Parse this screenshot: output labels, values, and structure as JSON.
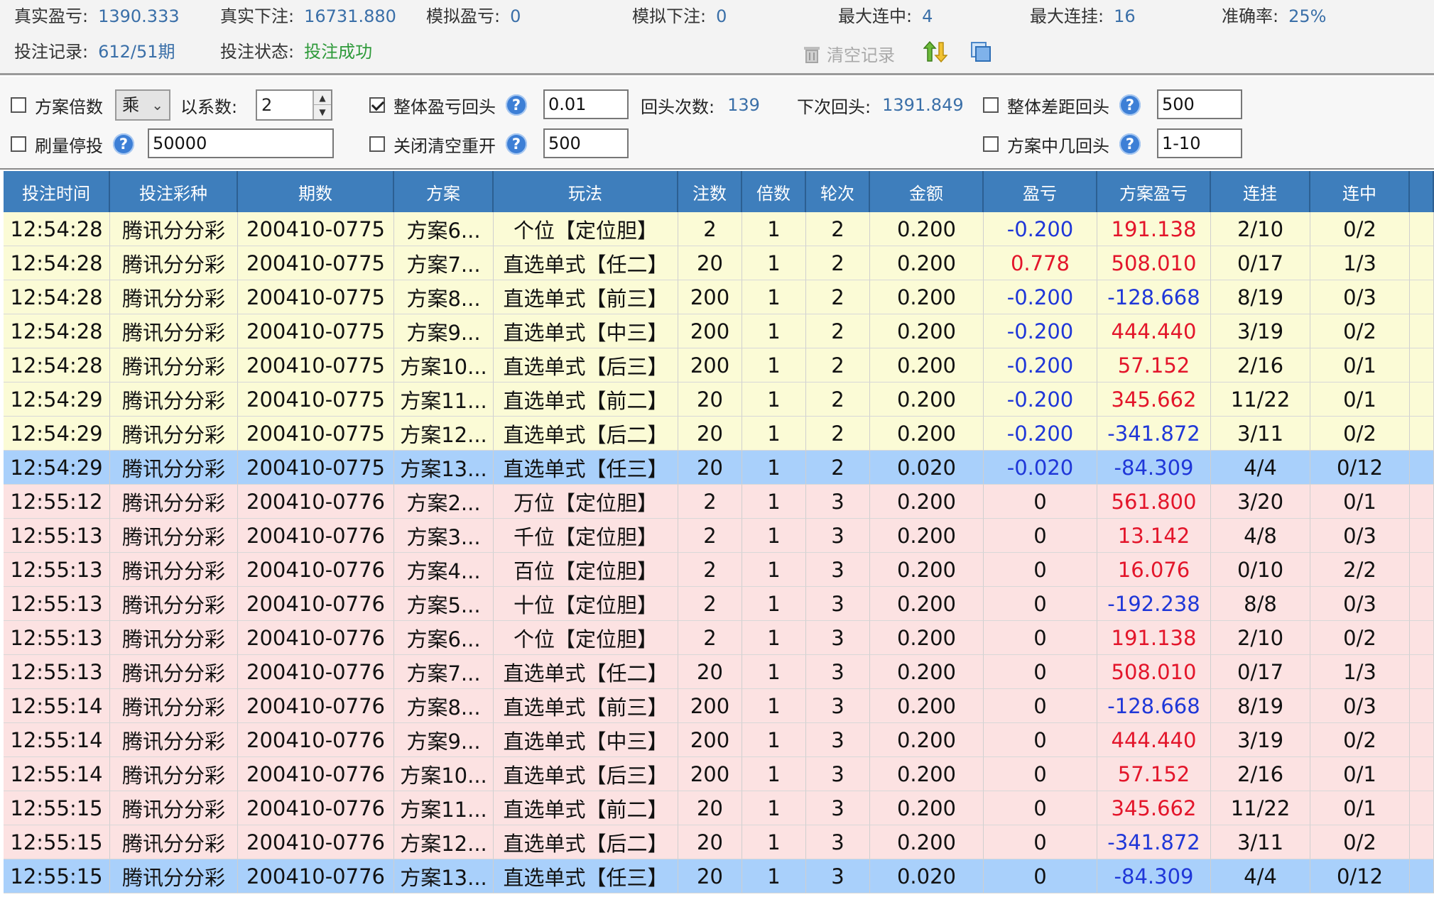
{
  "stats": {
    "real_profit_label": "真实盈亏:",
    "real_profit": "1390.333",
    "real_bet_label": "真实下注:",
    "real_bet": "16731.880",
    "sim_profit_label": "模拟盈亏:",
    "sim_profit": "0",
    "sim_bet_label": "模拟下注:",
    "sim_bet": "0",
    "max_win_streak_label": "最大连中:",
    "max_win_streak": "4",
    "max_loss_streak_label": "最大连挂:",
    "max_loss_streak": "16",
    "accuracy_label": "准确率:",
    "accuracy": "25%",
    "record_label": "投注记录:",
    "record": "612/51期",
    "status_label": "投注状态:",
    "status": "投注成功",
    "clear_label": "清空记录"
  },
  "settings": {
    "multiplier_label": "方案倍数",
    "op_value": "乘",
    "coef_label": "以系数:",
    "coef_value": "2",
    "overall_return_label": "整体盈亏回头",
    "overall_return_value": "0.01",
    "return_count_label": "回头次数:",
    "return_count": "139",
    "next_return_label": "下次回头:",
    "next_return": "1391.849",
    "gap_return_label": "整体差距回头",
    "gap_return_value": "500",
    "stop_label": "刷量停投",
    "stop_value": "50000",
    "close_label": "关闭清空重开",
    "close_value": "500",
    "hit_return_label": "方案中几回头",
    "hit_return_value": "1-10"
  },
  "columns": [
    "投注时间",
    "投注彩种",
    "期数",
    "方案",
    "玩法",
    "注数",
    "倍数",
    "轮次",
    "金额",
    "盈亏",
    "方案盈亏",
    "连挂",
    "连中"
  ],
  "rows": [
    {
      "bg": "yellow",
      "c": [
        "12:54:28",
        "腾讯分分彩",
        "200410-0775",
        "方案6...",
        "个位【定位胆】",
        "2",
        "1",
        "2",
        "0.200",
        "-0.200",
        "191.138",
        "2/10",
        "0/2"
      ]
    },
    {
      "bg": "yellow",
      "c": [
        "12:54:28",
        "腾讯分分彩",
        "200410-0775",
        "方案7...",
        "直选单式【任二】",
        "20",
        "1",
        "2",
        "0.200",
        "0.778",
        "508.010",
        "0/17",
        "1/3"
      ]
    },
    {
      "bg": "yellow",
      "c": [
        "12:54:28",
        "腾讯分分彩",
        "200410-0775",
        "方案8...",
        "直选单式【前三】",
        "200",
        "1",
        "2",
        "0.200",
        "-0.200",
        "-128.668",
        "8/19",
        "0/3"
      ]
    },
    {
      "bg": "yellow",
      "c": [
        "12:54:28",
        "腾讯分分彩",
        "200410-0775",
        "方案9...",
        "直选单式【中三】",
        "200",
        "1",
        "2",
        "0.200",
        "-0.200",
        "444.440",
        "3/19",
        "0/2"
      ]
    },
    {
      "bg": "yellow",
      "c": [
        "12:54:28",
        "腾讯分分彩",
        "200410-0775",
        "方案10...",
        "直选单式【后三】",
        "200",
        "1",
        "2",
        "0.200",
        "-0.200",
        "57.152",
        "2/16",
        "0/1"
      ]
    },
    {
      "bg": "yellow",
      "c": [
        "12:54:29",
        "腾讯分分彩",
        "200410-0775",
        "方案11...",
        "直选单式【前二】",
        "20",
        "1",
        "2",
        "0.200",
        "-0.200",
        "345.662",
        "11/22",
        "0/1"
      ]
    },
    {
      "bg": "yellow",
      "c": [
        "12:54:29",
        "腾讯分分彩",
        "200410-0775",
        "方案12...",
        "直选单式【后二】",
        "20",
        "1",
        "2",
        "0.200",
        "-0.200",
        "-341.872",
        "3/11",
        "0/2"
      ]
    },
    {
      "bg": "blue",
      "c": [
        "12:54:29",
        "腾讯分分彩",
        "200410-0775",
        "方案13...",
        "直选单式【任三】",
        "20",
        "1",
        "2",
        "0.020",
        "-0.020",
        "-84.309",
        "4/4",
        "0/12"
      ]
    },
    {
      "bg": "pink",
      "c": [
        "12:55:12",
        "腾讯分分彩",
        "200410-0776",
        "方案2...",
        "万位【定位胆】",
        "2",
        "1",
        "3",
        "0.200",
        "0",
        "561.800",
        "3/20",
        "0/1"
      ]
    },
    {
      "bg": "pink",
      "c": [
        "12:55:13",
        "腾讯分分彩",
        "200410-0776",
        "方案3...",
        "千位【定位胆】",
        "2",
        "1",
        "3",
        "0.200",
        "0",
        "13.142",
        "4/8",
        "0/3"
      ]
    },
    {
      "bg": "pink",
      "c": [
        "12:55:13",
        "腾讯分分彩",
        "200410-0776",
        "方案4...",
        "百位【定位胆】",
        "2",
        "1",
        "3",
        "0.200",
        "0",
        "16.076",
        "0/10",
        "2/2"
      ]
    },
    {
      "bg": "pink",
      "c": [
        "12:55:13",
        "腾讯分分彩",
        "200410-0776",
        "方案5...",
        "十位【定位胆】",
        "2",
        "1",
        "3",
        "0.200",
        "0",
        "-192.238",
        "8/8",
        "0/3"
      ]
    },
    {
      "bg": "pink",
      "c": [
        "12:55:13",
        "腾讯分分彩",
        "200410-0776",
        "方案6...",
        "个位【定位胆】",
        "2",
        "1",
        "3",
        "0.200",
        "0",
        "191.138",
        "2/10",
        "0/2"
      ]
    },
    {
      "bg": "pink",
      "c": [
        "12:55:13",
        "腾讯分分彩",
        "200410-0776",
        "方案7...",
        "直选单式【任二】",
        "20",
        "1",
        "3",
        "0.200",
        "0",
        "508.010",
        "0/17",
        "1/3"
      ]
    },
    {
      "bg": "pink",
      "c": [
        "12:55:14",
        "腾讯分分彩",
        "200410-0776",
        "方案8...",
        "直选单式【前三】",
        "200",
        "1",
        "3",
        "0.200",
        "0",
        "-128.668",
        "8/19",
        "0/3"
      ]
    },
    {
      "bg": "pink",
      "c": [
        "12:55:14",
        "腾讯分分彩",
        "200410-0776",
        "方案9...",
        "直选单式【中三】",
        "200",
        "1",
        "3",
        "0.200",
        "0",
        "444.440",
        "3/19",
        "0/2"
      ]
    },
    {
      "bg": "pink",
      "c": [
        "12:55:14",
        "腾讯分分彩",
        "200410-0776",
        "方案10...",
        "直选单式【后三】",
        "200",
        "1",
        "3",
        "0.200",
        "0",
        "57.152",
        "2/16",
        "0/1"
      ]
    },
    {
      "bg": "pink",
      "c": [
        "12:55:15",
        "腾讯分分彩",
        "200410-0776",
        "方案11...",
        "直选单式【前二】",
        "20",
        "1",
        "3",
        "0.200",
        "0",
        "345.662",
        "11/22",
        "0/1"
      ]
    },
    {
      "bg": "pink",
      "c": [
        "12:55:15",
        "腾讯分分彩",
        "200410-0776",
        "方案12...",
        "直选单式【后二】",
        "20",
        "1",
        "3",
        "0.200",
        "0",
        "-341.872",
        "3/11",
        "0/2"
      ]
    },
    {
      "bg": "blue",
      "c": [
        "12:55:15",
        "腾讯分分彩",
        "200410-0776",
        "方案13...",
        "直选单式【任三】",
        "20",
        "1",
        "3",
        "0.020",
        "0",
        "-84.309",
        "4/4",
        "0/12"
      ]
    }
  ],
  "colors": {
    "header": "#3e7ebc",
    "negative": "#1f37d8",
    "positive": "#e3152a",
    "value": "#3a6fa8",
    "success": "#2e9a3a"
  }
}
